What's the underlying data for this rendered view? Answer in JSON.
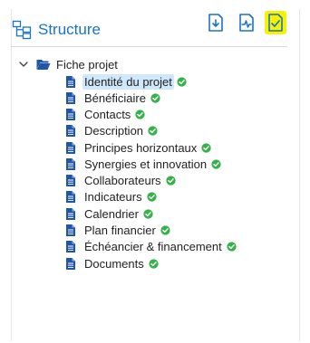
{
  "panel": {
    "title": "Structure",
    "title_icon": "tree-structure-icon",
    "toolbar": [
      {
        "name": "download-file-icon"
      },
      {
        "name": "file-activity-icon"
      },
      {
        "name": "file-check-icon",
        "highlight": "#f7f200"
      }
    ]
  },
  "tree": {
    "root": {
      "label": "Fiche projet",
      "expanded": true,
      "icon": "folder-open-icon"
    },
    "items": [
      {
        "label": "Identité du projet",
        "selected": true,
        "status": "complete"
      },
      {
        "label": "Bénéficiaire",
        "status": "complete"
      },
      {
        "label": "Contacts",
        "status": "complete"
      },
      {
        "label": "Description",
        "status": "complete"
      },
      {
        "label": "Principes horizontaux",
        "status": "complete"
      },
      {
        "label": "Synergies et innovation",
        "status": "complete"
      },
      {
        "label": "Collaborateurs",
        "status": "complete"
      },
      {
        "label": "Indicateurs",
        "status": "complete"
      },
      {
        "label": "Calendrier",
        "status": "complete"
      },
      {
        "label": "Plan financier",
        "status": "complete"
      },
      {
        "label": "Échéancier & financement",
        "status": "complete"
      },
      {
        "label": "Documents",
        "status": "complete"
      }
    ]
  },
  "colors": {
    "accent": "#1a73c8",
    "doc_icon": "#1f56a8",
    "check": "#35b34a",
    "selected_bg": "#cfe8fb"
  }
}
